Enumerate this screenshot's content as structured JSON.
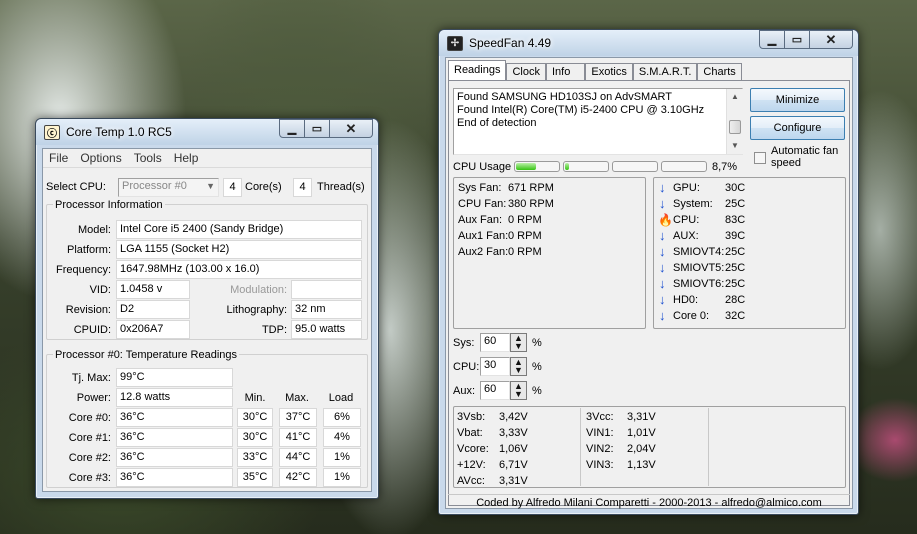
{
  "coretemp": {
    "title": "Core Temp 1.0 RC5",
    "icon": "coretemp-icon",
    "menu": [
      "File",
      "Options",
      "Tools",
      "Help"
    ],
    "select_cpu_label": "Select CPU:",
    "select_cpu_value": "Processor #0",
    "cores_count": "4",
    "cores_label": "Core(s)",
    "threads_count": "4",
    "threads_label": "Thread(s)",
    "proc_info_title": "Processor Information",
    "model_label": "Model:",
    "model_value": "Intel Core i5 2400 (Sandy Bridge)",
    "platform_label": "Platform:",
    "platform_value": "LGA 1155 (Socket H2)",
    "frequency_label": "Frequency:",
    "frequency_value": "1647.98MHz (103.00 x 16.0)",
    "vid_label": "VID:",
    "vid_value": "1.0458 v",
    "modulation_label": "Modulation:",
    "modulation_value": "",
    "revision_label": "Revision:",
    "revision_value": "D2",
    "lithography_label": "Lithography:",
    "lithography_value": "32 nm",
    "cpuid_label": "CPUID:",
    "cpuid_value": "0x206A7",
    "tdp_label": "TDP:",
    "tdp_value": "95.0 watts",
    "temp_title": "Processor #0: Temperature Readings",
    "tjmax_label": "Tj. Max:",
    "tjmax_value": "99°C",
    "power_label": "Power:",
    "power_value": "12.8 watts",
    "col_min": "Min.",
    "col_max": "Max.",
    "col_load": "Load",
    "cores": [
      {
        "label": "Core #0:",
        "temp": "36°C",
        "min": "30°C",
        "max": "37°C",
        "load": "6%"
      },
      {
        "label": "Core #1:",
        "temp": "36°C",
        "min": "30°C",
        "max": "41°C",
        "load": "4%"
      },
      {
        "label": "Core #2:",
        "temp": "36°C",
        "min": "33°C",
        "max": "44°C",
        "load": "1%"
      },
      {
        "label": "Core #3:",
        "temp": "36°C",
        "min": "35°C",
        "max": "42°C",
        "load": "1%"
      }
    ]
  },
  "speedfan": {
    "title": "SpeedFan 4.49",
    "icon": "speedfan-icon",
    "tabs": [
      "Readings",
      "Clock",
      "Info",
      "Exotics",
      "S.M.A.R.T.",
      "Charts"
    ],
    "active_tab": "Readings",
    "log_lines": [
      "Found SAMSUNG HD103SJ on AdvSMART",
      "Found Intel(R) Core(TM) i5-2400 CPU @ 3.10GHz",
      "End of detection"
    ],
    "minimize_label": "Minimize",
    "configure_label": "Configure",
    "auto_fan_label": "Automatic fan speed",
    "cpu_usage_label": "CPU Usage",
    "cpu_usage_value": "8,7%",
    "cpu_bars": [
      0.45,
      0.1,
      0.0,
      0.0
    ],
    "fans": [
      {
        "label": "Sys Fan:",
        "value": "671 RPM"
      },
      {
        "label": "CPU Fan:",
        "value": "380 RPM"
      },
      {
        "label": "Aux Fan:",
        "value": "0 RPM"
      },
      {
        "label": "Aux1 Fan:",
        "value": "0 RPM"
      },
      {
        "label": "Aux2 Fan:",
        "value": "0 RPM"
      }
    ],
    "temps": [
      {
        "label": "GPU:",
        "value": "30C",
        "icon": "arrow-down-icon"
      },
      {
        "label": "System:",
        "value": "25C",
        "icon": "arrow-down-icon"
      },
      {
        "label": "CPU:",
        "value": "83C",
        "icon": "flame-icon"
      },
      {
        "label": "AUX:",
        "value": "39C",
        "icon": "arrow-down-icon"
      },
      {
        "label": "SMIOVT4:",
        "value": "25C",
        "icon": "arrow-down-icon"
      },
      {
        "label": "SMIOVT5:",
        "value": "25C",
        "icon": "arrow-down-icon"
      },
      {
        "label": "SMIOVT6:",
        "value": "25C",
        "icon": "arrow-down-icon"
      },
      {
        "label": "HD0:",
        "value": "28C",
        "icon": "arrow-down-icon"
      },
      {
        "label": "Core 0:",
        "value": "32C",
        "icon": "arrow-down-icon"
      }
    ],
    "speeds": [
      {
        "label": "Sys:",
        "value": "60",
        "unit": "%"
      },
      {
        "label": "CPU:",
        "value": "30",
        "unit": "%"
      },
      {
        "label": "Aux:",
        "value": "60",
        "unit": "%"
      }
    ],
    "volts_left": [
      {
        "label": "3Vsb:",
        "value": "3,42V"
      },
      {
        "label": "Vbat:",
        "value": "3,33V"
      },
      {
        "label": "Vcore:",
        "value": "1,06V"
      },
      {
        "label": "+12V:",
        "value": "6,71V"
      },
      {
        "label": "AVcc:",
        "value": "3,31V"
      }
    ],
    "volts_right": [
      {
        "label": "3Vcc:",
        "value": "3,31V"
      },
      {
        "label": "VIN1:",
        "value": "1,01V"
      },
      {
        "label": "VIN2:",
        "value": "2,04V"
      },
      {
        "label": "VIN3:",
        "value": "1,13V"
      }
    ],
    "status": "Coded by Alfredo Milani Comparetti - 2000-2013 - alfredo@almico.com"
  }
}
